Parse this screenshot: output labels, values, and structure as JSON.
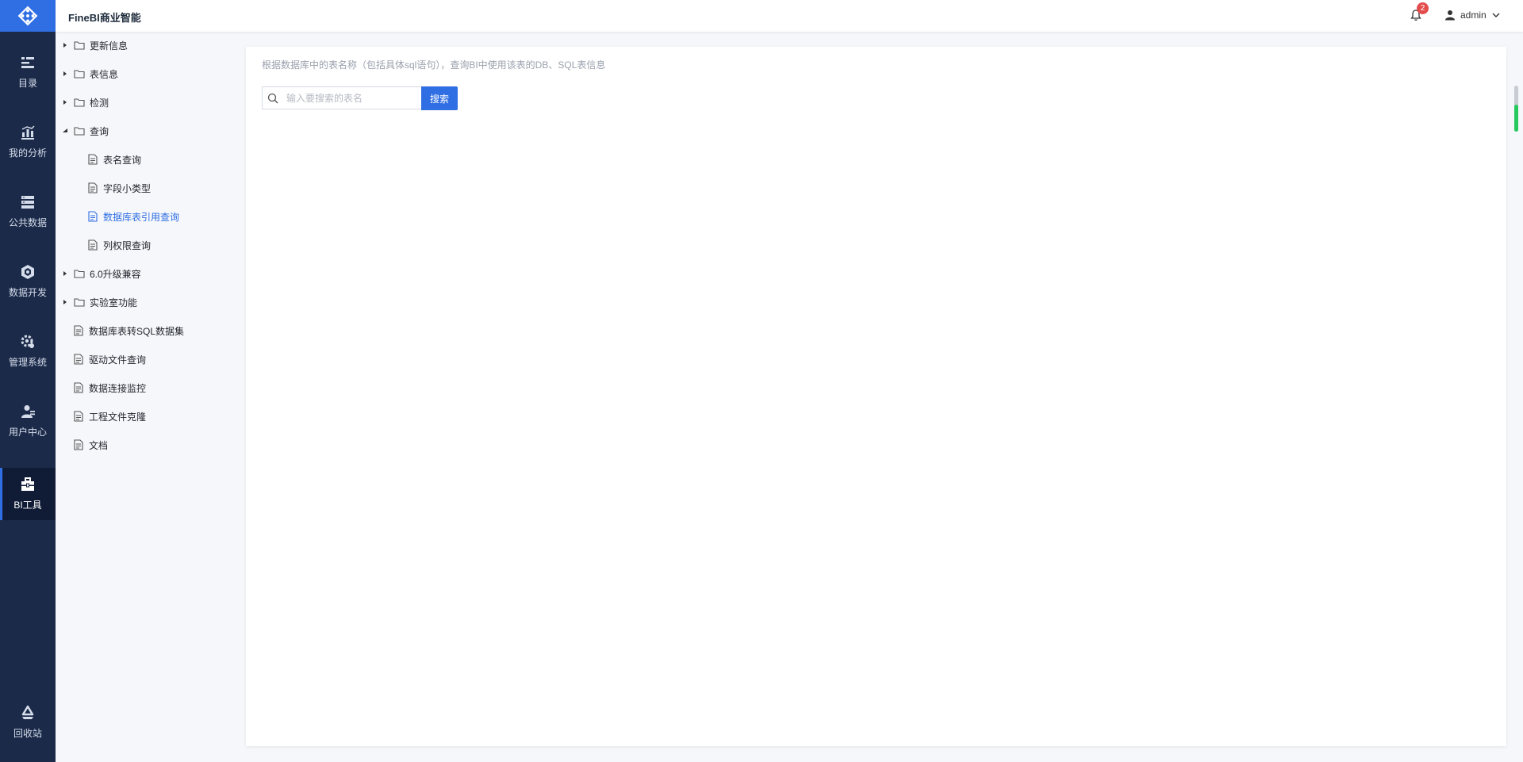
{
  "header": {
    "app_title": "FineBI商业智能",
    "notification_count": "2",
    "username": "admin"
  },
  "nav": {
    "items": [
      {
        "label": "目录",
        "icon": "catalog-icon"
      },
      {
        "label": "我的分析",
        "icon": "analysis-icon"
      },
      {
        "label": "公共数据",
        "icon": "public-data-icon"
      },
      {
        "label": "数据开发",
        "icon": "data-dev-icon"
      },
      {
        "label": "管理系统",
        "icon": "gear-icon"
      },
      {
        "label": "用户中心",
        "icon": "user-center-icon"
      },
      {
        "label": "BI工具",
        "icon": "toolbox-icon",
        "active": true
      }
    ],
    "recycle_label": "回收站"
  },
  "tree": {
    "items": [
      {
        "label": "更新信息",
        "type": "folder",
        "expanded": false
      },
      {
        "label": "表信息",
        "type": "folder",
        "expanded": false
      },
      {
        "label": "检测",
        "type": "folder",
        "expanded": false
      },
      {
        "label": "查询",
        "type": "folder",
        "expanded": true
      },
      {
        "label": "表名查询",
        "type": "file"
      },
      {
        "label": "字段小类型",
        "type": "file"
      },
      {
        "label": "数据库表引用查询",
        "type": "file",
        "active": true
      },
      {
        "label": "列权限查询",
        "type": "file"
      },
      {
        "label": "6.0升级兼容",
        "type": "folder",
        "expanded": false
      },
      {
        "label": "实验室功能",
        "type": "folder",
        "expanded": false
      },
      {
        "label": "数据库表转SQL数据集",
        "type": "file"
      },
      {
        "label": "驱动文件查询",
        "type": "file"
      },
      {
        "label": "数据连接监控",
        "type": "file"
      },
      {
        "label": "工程文件克隆",
        "type": "file"
      },
      {
        "label": "文档",
        "type": "file"
      }
    ]
  },
  "main": {
    "description": "根据数据库中的表名称（包括具体sql语句），查询BI中使用该表的DB、SQL表信息",
    "search_placeholder": "输入要搜索的表名",
    "search_button": "搜索"
  },
  "colors": {
    "accent": "#2f6ee3",
    "nav_bg": "#1b2a49",
    "badge": "#e44c4c"
  }
}
